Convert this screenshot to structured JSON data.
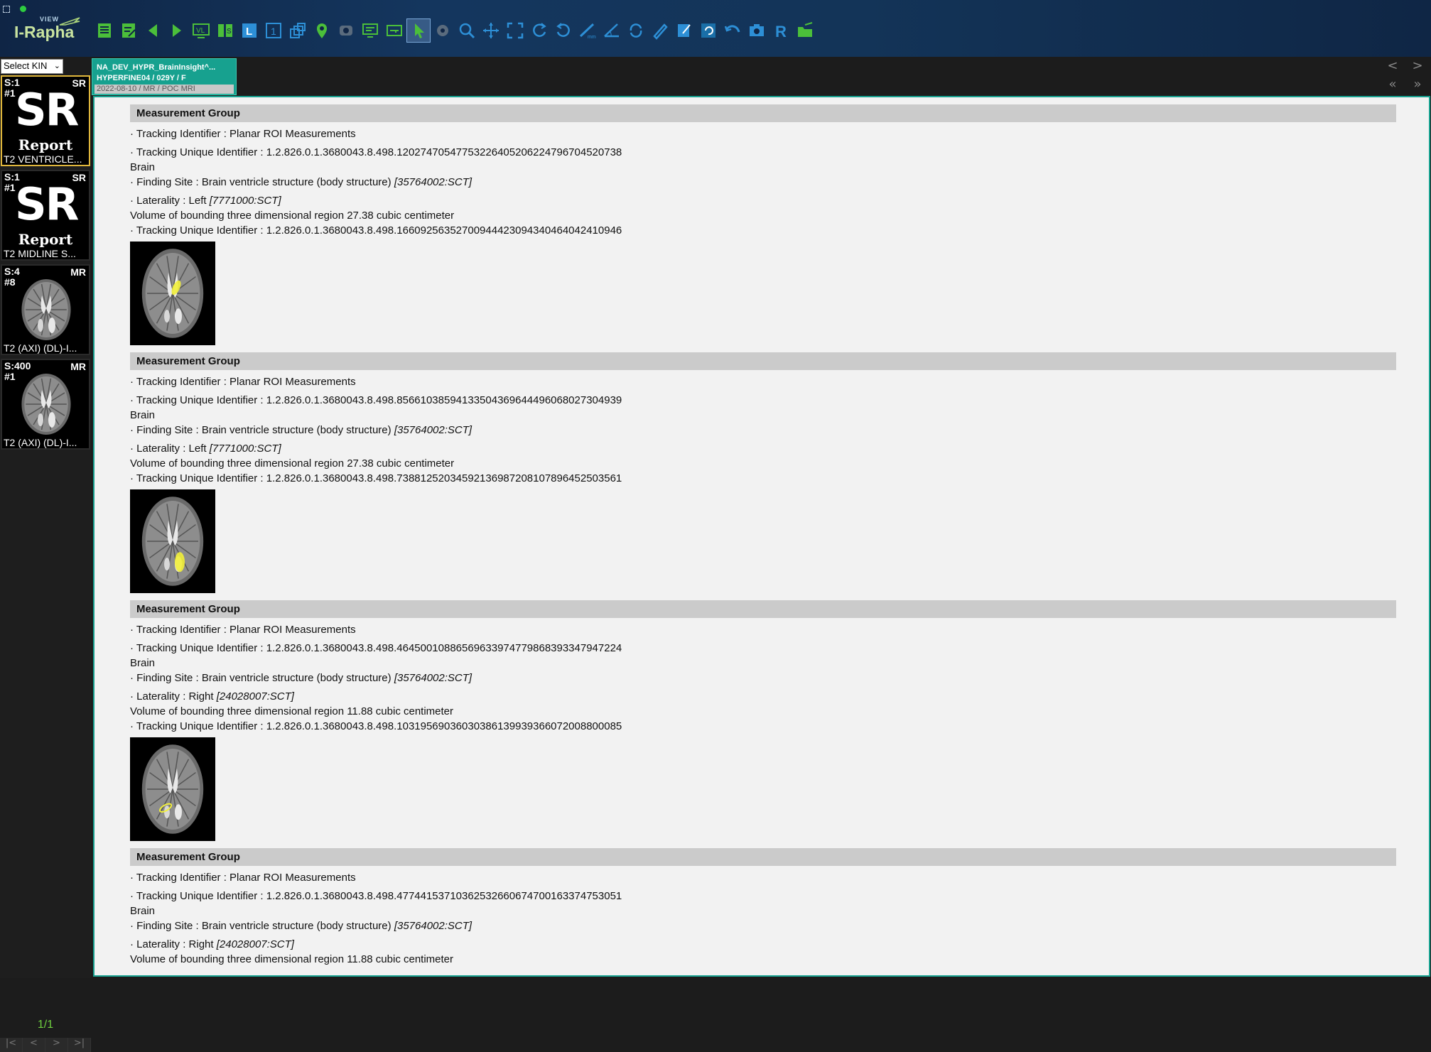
{
  "app": {
    "logo_view": "VIEW",
    "logo_name": "I-Rapha"
  },
  "toolbar": {
    "buttons": [
      {
        "icon": "list-icon"
      },
      {
        "icon": "notes-icon"
      },
      {
        "icon": "prev-icon"
      },
      {
        "icon": "next-icon"
      },
      {
        "icon": "vl-icon",
        "label": "VL"
      },
      {
        "icon": "series-sync-icon"
      },
      {
        "icon": "layout-l-icon",
        "label": "L"
      },
      {
        "icon": "layout-1-icon",
        "label": "1"
      },
      {
        "icon": "stack-icon"
      },
      {
        "icon": "location-pin-icon"
      },
      {
        "icon": "record-icon"
      },
      {
        "icon": "monitor-icon"
      },
      {
        "icon": "key-icon"
      },
      {
        "icon": "pointer-icon"
      },
      {
        "icon": "gear-icon"
      },
      {
        "icon": "zoom-icon"
      },
      {
        "icon": "pan-icon"
      },
      {
        "icon": "fit-icon"
      },
      {
        "icon": "rotate-left-icon"
      },
      {
        "icon": "rotate-right-icon"
      },
      {
        "icon": "ruler-icon"
      },
      {
        "icon": "angle-icon"
      },
      {
        "icon": "rotate-icon"
      },
      {
        "icon": "pencil-icon"
      },
      {
        "icon": "edit-icon"
      },
      {
        "icon": "reset-icon"
      },
      {
        "icon": "undo-icon"
      },
      {
        "icon": "camera-icon"
      },
      {
        "icon": "r-icon",
        "label": "R"
      },
      {
        "icon": "folder-icon"
      }
    ],
    "colors": {
      "green": "#4bbf3a",
      "blue": "#2d8fd6",
      "teal": "#1aa79a"
    }
  },
  "patient_bar": {
    "kin_select": "Select KIN",
    "study_tab": {
      "line1": "NA_DEV_HYPR_BrainInsight^...",
      "line2": "HYPERFINE04 / 029Y / F",
      "line3": "2022-08-10 / MR / POC MRI"
    },
    "nav": [
      "<",
      ">",
      "«",
      "»"
    ]
  },
  "left_panel": {
    "thumbnails": [
      {
        "series": "S:1",
        "image": "#1",
        "modality": "SR",
        "big": "SR",
        "report": "Report",
        "desc": "T2 VENTRICLE...",
        "selected": true,
        "type": "sr"
      },
      {
        "series": "S:1",
        "image": "#1",
        "modality": "SR",
        "big": "SR",
        "report": "Report",
        "desc": "T2 MIDLINE S...",
        "selected": false,
        "type": "sr"
      },
      {
        "series": "S:4",
        "image": "#8",
        "modality": "MR",
        "desc": "T2 (AXI) (DL)-I...",
        "selected": false,
        "type": "mr"
      },
      {
        "series": "S:400",
        "image": "#1",
        "modality": "MR",
        "desc": "T2 (AXI) (DL)-I...",
        "selected": false,
        "type": "mr"
      }
    ],
    "page": "1/1",
    "nav": [
      "|<",
      "<",
      ">",
      ">|"
    ]
  },
  "report": {
    "groups": [
      {
        "header": "Measurement Group",
        "tracking_identifier": "· Tracking Identifier : Planar ROI Measurements",
        "tracking_uid": "· Tracking Unique Identifier : 1.2.826.0.1.3680043.8.498.12027470547753226405206224796704520738",
        "organ": "Brain",
        "finding_site": "· Finding Site : Brain ventricle structure (body structure) ",
        "finding_code": "[35764002:SCT]",
        "laterality": "· Laterality : Left ",
        "laterality_code": "[7771000:SCT]",
        "volume": "Volume of bounding three dimensional region 27.38 cubic centimeter",
        "roi_uid": "· Tracking Unique Identifier : 1.2.826.0.1.3680043.8.498.16609256352700944423094340464042410946"
      },
      {
        "header": "Measurement Group",
        "tracking_identifier": "· Tracking Identifier : Planar ROI Measurements",
        "tracking_uid": "· Tracking Unique Identifier : 1.2.826.0.1.3680043.8.498.85661038594133504369644496068027304939",
        "organ": "Brain",
        "finding_site": "· Finding Site : Brain ventricle structure (body structure) ",
        "finding_code": "[35764002:SCT]",
        "laterality": "· Laterality : Left ",
        "laterality_code": "[7771000:SCT]",
        "volume": "Volume of bounding three dimensional region 27.38 cubic centimeter",
        "roi_uid": "· Tracking Unique Identifier : 1.2.826.0.1.3680043.8.498.73881252034592136987208107896452503561"
      },
      {
        "header": "Measurement Group",
        "tracking_identifier": "· Tracking Identifier : Planar ROI Measurements",
        "tracking_uid": "· Tracking Unique Identifier : 1.2.826.0.1.3680043.8.498.46450010886569633974779868393347947224",
        "organ": "Brain",
        "finding_site": "· Finding Site : Brain ventricle structure (body structure) ",
        "finding_code": "[35764002:SCT]",
        "laterality": "· Laterality : Right ",
        "laterality_code": "[24028007:SCT]",
        "volume": "Volume of bounding three dimensional region 11.88 cubic centimeter",
        "roi_uid": "· Tracking Unique Identifier : 1.2.826.0.1.3680043.8.498.10319569036030386139939366072008800085"
      },
      {
        "header": "Measurement Group",
        "tracking_identifier": "· Tracking Identifier : Planar ROI Measurements",
        "tracking_uid": "· Tracking Unique Identifier : 1.2.826.0.1.3680043.8.498.47744153710362532660674700163374753051",
        "organ": "Brain",
        "finding_site": "· Finding Site : Brain ventricle structure (body structure) ",
        "finding_code": "[35764002:SCT]",
        "laterality": "· Laterality : Right ",
        "laterality_code": "[24028007:SCT]",
        "volume": "Volume of bounding three dimensional region 11.88 cubic centimeter",
        "roi_uid": ""
      }
    ],
    "roi_color": "#f2f03a"
  }
}
